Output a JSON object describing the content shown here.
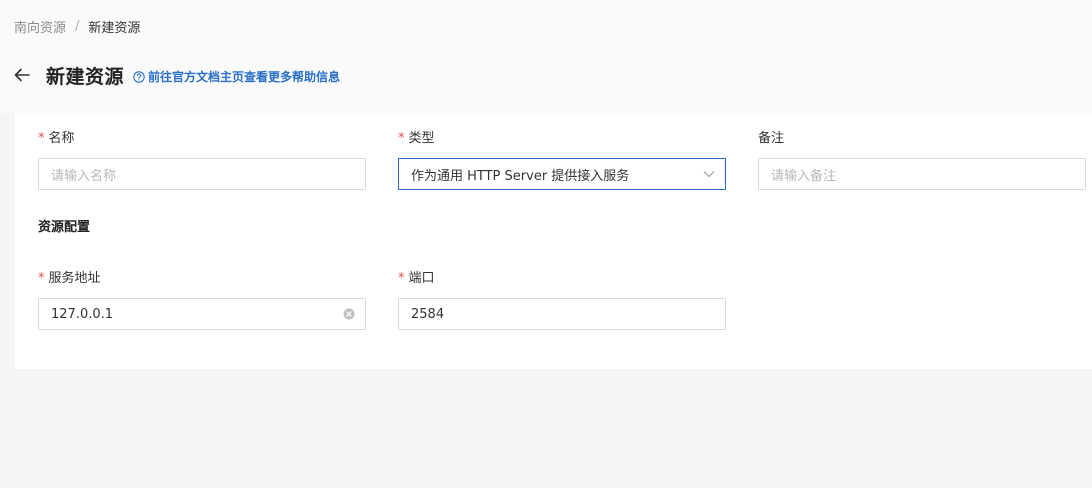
{
  "breadcrumb": {
    "parent": "南向资源",
    "separator": "/",
    "current": "新建资源"
  },
  "header": {
    "title": "新建资源",
    "help_link": "前往官方文档主页查看更多帮助信息"
  },
  "form": {
    "name": {
      "required_mark": "*",
      "label": "名称",
      "placeholder": "请输入名称",
      "value": ""
    },
    "type": {
      "required_mark": "*",
      "label": "类型",
      "value": "作为通用 HTTP Server 提供接入服务"
    },
    "remark": {
      "label": "备注",
      "placeholder": "请输入备注",
      "value": ""
    },
    "section_title": "资源配置",
    "address": {
      "required_mark": "*",
      "label": "服务地址",
      "value": "127.0.0.1"
    },
    "port": {
      "required_mark": "*",
      "label": "端口",
      "value": "2584"
    }
  },
  "colors": {
    "accent": "#2a70c9",
    "required": "#e34d4d",
    "background": "#f5f5f5"
  },
  "icons": {
    "back": "arrow-left-icon",
    "help": "question-circle-icon",
    "select": "chevron-down-icon",
    "clear": "clear-circle-icon"
  }
}
